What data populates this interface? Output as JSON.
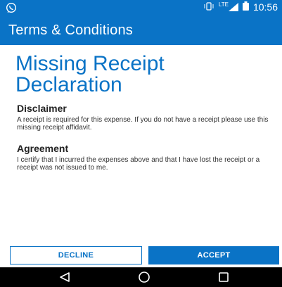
{
  "status_bar": {
    "time": "10:56",
    "network": "LTE",
    "icons": [
      "whatsapp-icon",
      "vibrate-icon",
      "signal-icon",
      "battery-icon"
    ]
  },
  "app_bar": {
    "title": "Terms & Conditions"
  },
  "page": {
    "title": "Missing Receipt Declaration",
    "sections": [
      {
        "heading": "Disclaimer",
        "body": "A receipt is required for this expense. If you do not have a receipt please use this missing receipt affidavit."
      },
      {
        "heading": "Agreement",
        "body": "I certify that I incurred the expenses above and that I have lost the receipt or a receipt was not issued to me."
      }
    ]
  },
  "actions": {
    "decline_label": "DECLINE",
    "accept_label": "ACCEPT"
  },
  "nav_bar": {
    "items": [
      "back-icon",
      "home-icon",
      "recents-icon"
    ]
  },
  "colors": {
    "primary": "#0a73c6",
    "nav_bar": "#000000",
    "text": "#333333"
  }
}
